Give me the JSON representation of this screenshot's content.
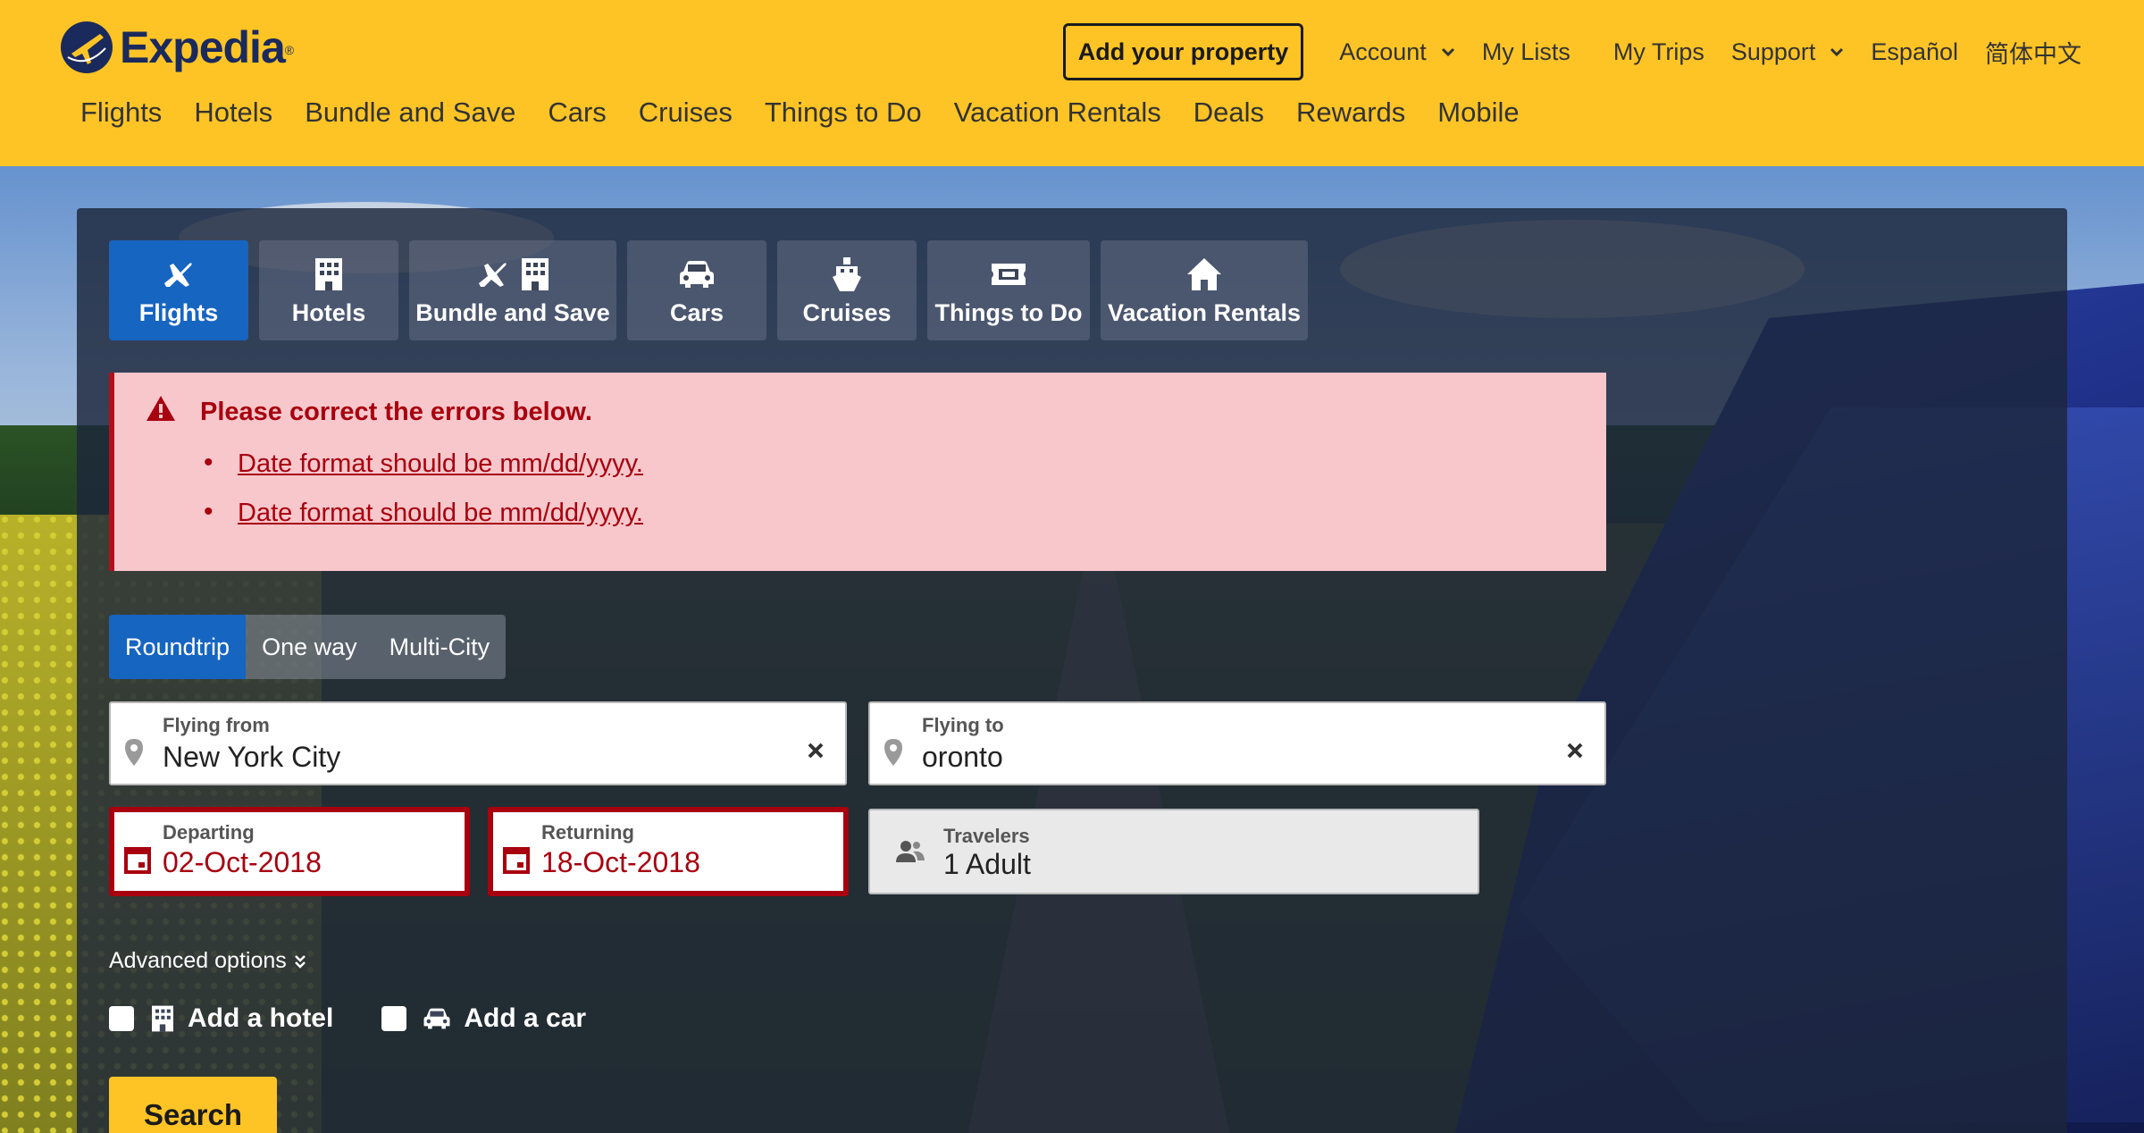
{
  "brand": {
    "name": "Expedia",
    "tm": "®"
  },
  "header": {
    "add_property": "Add your property",
    "utility": [
      {
        "label": "Account",
        "dropdown": true
      },
      {
        "label": "My Lists",
        "dropdown": false
      },
      {
        "label": "My Trips",
        "dropdown": false
      },
      {
        "label": "Support",
        "dropdown": true
      },
      {
        "label": "Español",
        "dropdown": false
      },
      {
        "label": "简体中文",
        "dropdown": false
      }
    ],
    "nav": [
      "Flights",
      "Hotels",
      "Bundle and Save",
      "Cars",
      "Cruises",
      "Things to Do",
      "Vacation Rentals",
      "Deals",
      "Rewards",
      "Mobile"
    ]
  },
  "search": {
    "tabs": [
      {
        "label": "Flights",
        "icon": "plane-icon",
        "active": true
      },
      {
        "label": "Hotels",
        "icon": "hotel-icon",
        "active": false
      },
      {
        "label": "Bundle and Save",
        "icon": "plane-hotel-icon",
        "active": false
      },
      {
        "label": "Cars",
        "icon": "car-icon",
        "active": false
      },
      {
        "label": "Cruises",
        "icon": "ship-icon",
        "active": false
      },
      {
        "label": "Things to Do",
        "icon": "ticket-icon",
        "active": false
      },
      {
        "label": "Vacation Rentals",
        "icon": "house-icon",
        "active": false
      }
    ],
    "error": {
      "title": "Please correct the errors below.",
      "items": [
        "Date format should be mm/dd/yyyy.",
        "Date format should be mm/dd/yyyy."
      ]
    },
    "trip_types": [
      {
        "label": "Roundtrip",
        "active": true
      },
      {
        "label": "One way",
        "active": false
      },
      {
        "label": "Multi-City",
        "active": false
      }
    ],
    "flying_from": {
      "label": "Flying from",
      "value": "New York City"
    },
    "flying_to": {
      "label": "Flying to",
      "value": "oronto"
    },
    "departing": {
      "label": "Departing",
      "value": "02-Oct-2018"
    },
    "returning": {
      "label": "Returning",
      "value": "18-Oct-2018"
    },
    "travelers": {
      "label": "Travelers",
      "value": "1 Adult"
    },
    "advanced_options": "Advanced options",
    "add_hotel": "Add a hotel",
    "add_car": "Add a car",
    "search_button": "Search"
  },
  "colors": {
    "header": "#fec425",
    "active_tab": "#1665c1",
    "error": "#a8000f",
    "error_bg": "#f7c7cb"
  }
}
